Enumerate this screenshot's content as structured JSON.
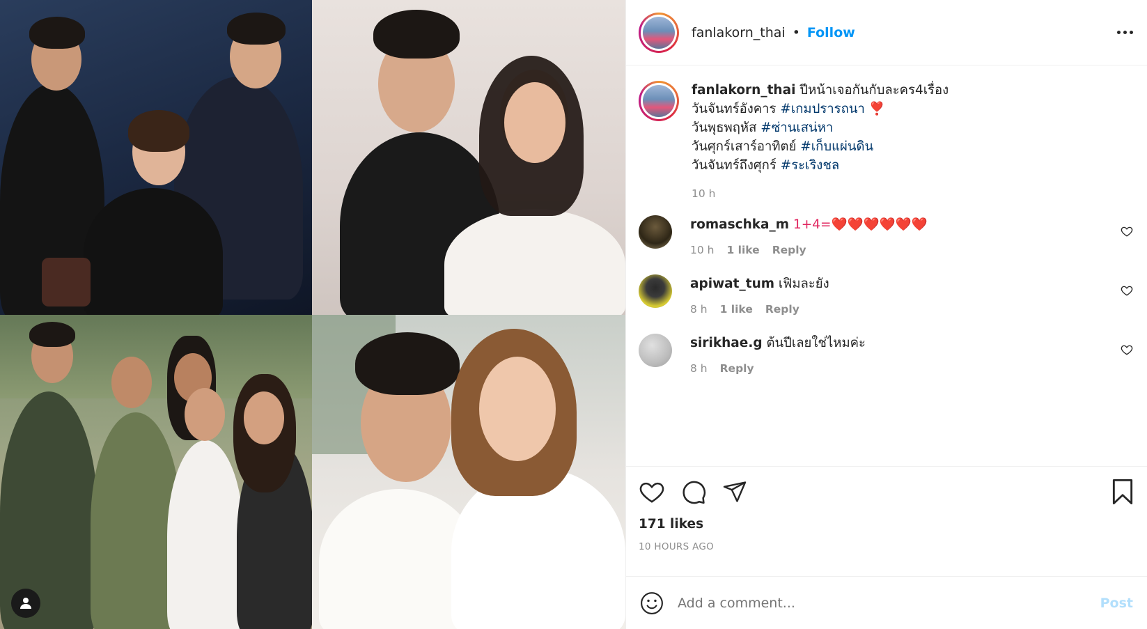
{
  "header": {
    "username": "fanlakorn_thai",
    "separator": "•",
    "follow_label": "Follow"
  },
  "caption": {
    "username": "fanlakorn_thai",
    "lines": [
      {
        "text": "ปีหน้าเจอกันกับละคร4เรื่อง",
        "hashtag": ""
      },
      {
        "text": "วันจันทร์อังคาร ",
        "hashtag": "#เกมปรารถนา",
        "emoji": "❣️"
      },
      {
        "text": "วันพุธพฤหัส ",
        "hashtag": "#ซ่านเสน่หา"
      },
      {
        "text": "วันศุกร์เสาร์อาทิตย์ ",
        "hashtag": "#เก็บแผ่นดิน"
      },
      {
        "text": "วันจันทร์ถึงศุกร์ ",
        "hashtag": "#ระเริงชล"
      }
    ],
    "time": "10 h"
  },
  "comments": [
    {
      "username": "romaschka_m",
      "text": "1+4=❤️❤️❤️❤️❤️❤️",
      "time": "10 h",
      "likes": "1 like",
      "reply": "Reply"
    },
    {
      "username": "apiwat_tum",
      "text": "เฟิมละยัง",
      "time": "8 h",
      "likes": "1 like",
      "reply": "Reply"
    },
    {
      "username": "sirikhae.g",
      "text": "ต้นปีเลยใช่ไหมค่ะ",
      "time": "8 h",
      "likes": "",
      "reply": "Reply"
    }
  ],
  "post": {
    "likes": "171 likes",
    "time_ago": "10 HOURS AGO"
  },
  "add_comment": {
    "placeholder": "Add a comment...",
    "post_label": "Post"
  },
  "colors": {
    "accent": "#0095f6",
    "hashtag": "#00376b",
    "muted": "#8e8e8e"
  },
  "icons": [
    "user-tag-icon",
    "more-icon",
    "heart-icon",
    "comment-icon",
    "share-icon",
    "bookmark-icon",
    "emoji-icon"
  ]
}
